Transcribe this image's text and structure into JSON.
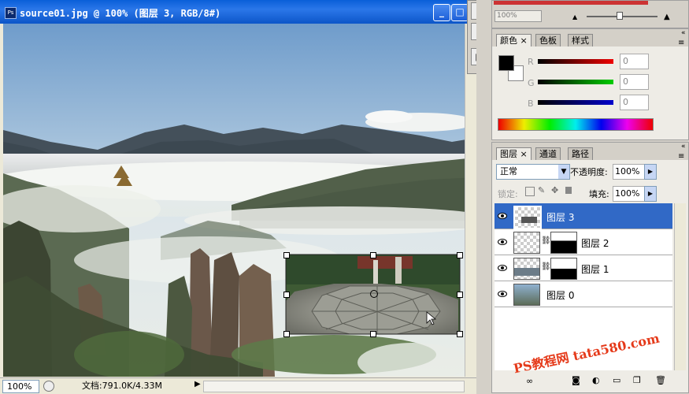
{
  "document": {
    "title": "source01.jpg @ 100% (图层 3, RGB/8#)",
    "zoom": "100%",
    "doc_info": "文档:791.0K/4.33M"
  },
  "tools": {
    "icon1": "A",
    "icon2": "¶",
    "icon3": "▤"
  },
  "navigator": {
    "zoom": "100%"
  },
  "color_panel": {
    "tabs": [
      "颜色",
      "色板",
      "样式"
    ],
    "r_label": "R",
    "g_label": "G",
    "b_label": "B",
    "r_value": "0",
    "g_value": "0",
    "b_value": "0",
    "foreground": "#000000",
    "background": "#ffffff"
  },
  "layers_panel": {
    "tabs": [
      "图层",
      "通道",
      "路径"
    ],
    "blend_mode": "正常",
    "opacity_label": "不透明度:",
    "opacity_value": "100%",
    "lock_label": "锁定:",
    "fill_label": "填充:",
    "fill_value": "100%",
    "layers": [
      {
        "name": "图层 3",
        "selected": true
      },
      {
        "name": "图层 2",
        "selected": false
      },
      {
        "name": "图层 1",
        "selected": false
      },
      {
        "name": "图层 0",
        "selected": false
      }
    ]
  },
  "watermark": "PS教程网 tata580.com"
}
